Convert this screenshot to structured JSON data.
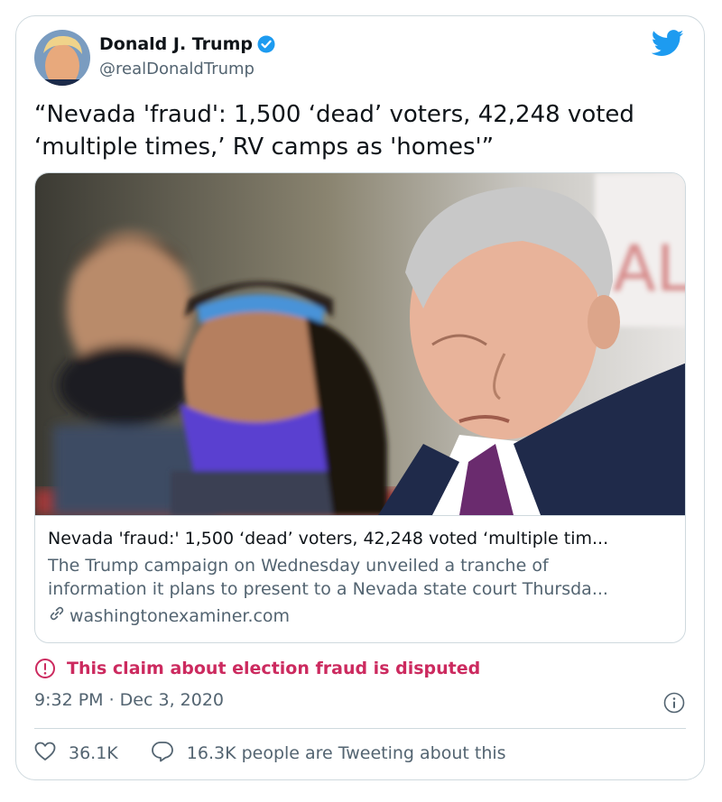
{
  "author": {
    "display_name": "Donald J. Trump",
    "handle": "@realDonaldTrump",
    "verified": true
  },
  "tweet": {
    "text": "“Nevada 'fraud': 1,500 ‘dead’ voters, 42,248 voted ‘multiple times,’ RV camps as 'homes'”"
  },
  "link_card": {
    "title": "Nevada 'fraud:' 1,500 ‘dead’ voters, 42,248 voted ‘multiple tim...",
    "description_line1": "The Trump campaign on Wednesday unveiled a tranche of",
    "description_line2": "information it plans to present to a Nevada state court Thursda...",
    "domain": "washingtonexaminer.com"
  },
  "label": {
    "text": "This claim about election fraud is disputed"
  },
  "timestamp": "9:32 PM · Dec 3, 2020",
  "actions": {
    "likes": "36.1K",
    "tweeting": "16.3K people are Tweeting about this"
  },
  "colors": {
    "accent": "#1d9bf0",
    "dispute": "#cc2a5f",
    "secondary_text": "#536471",
    "border": "#cfd9de"
  },
  "icons": [
    "twitter-bird-icon",
    "verified-badge-icon",
    "link-icon",
    "alert-icon",
    "info-icon",
    "heart-icon",
    "reply-icon"
  ]
}
